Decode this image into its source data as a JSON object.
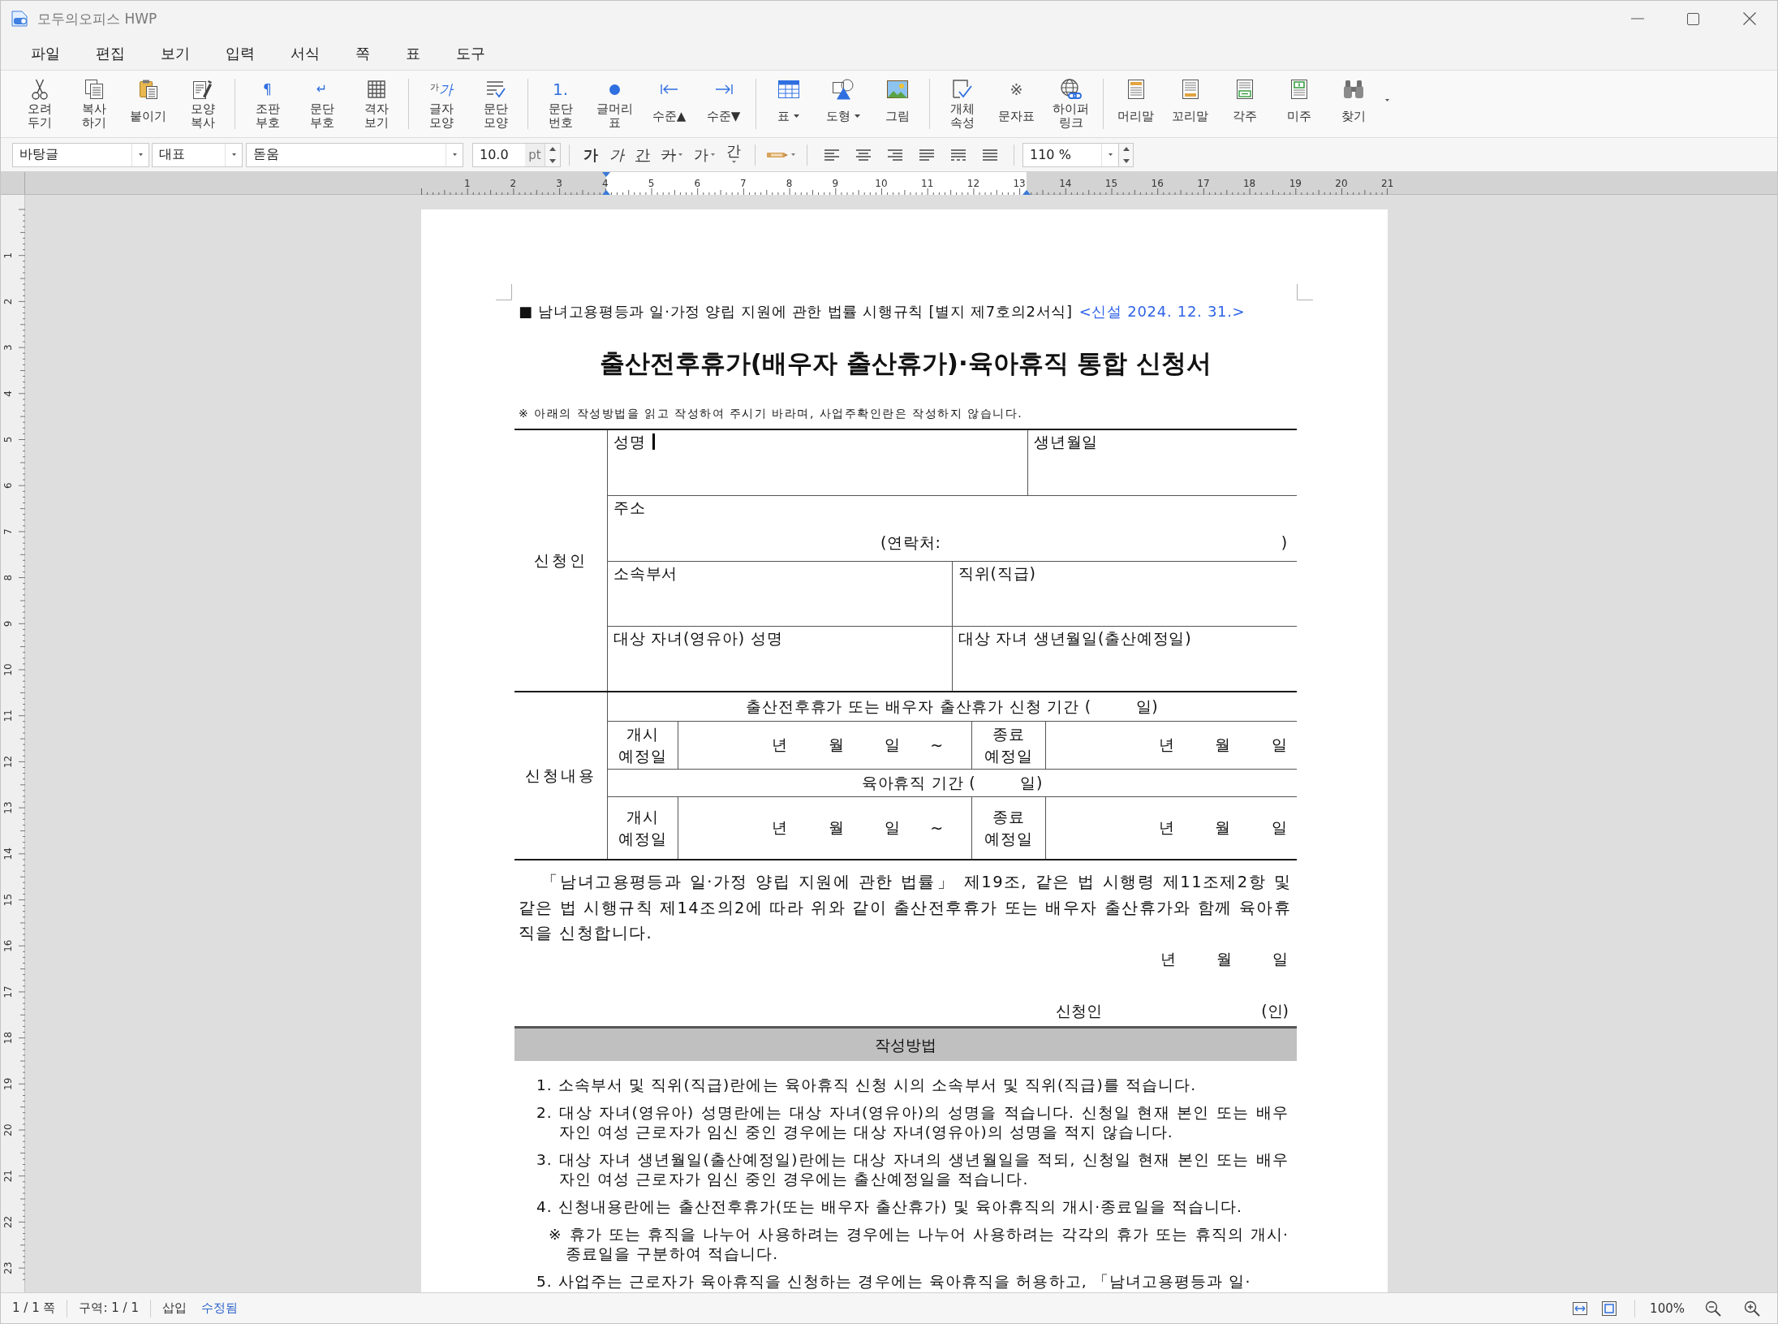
{
  "window": {
    "title": "모두의오피스 HWP"
  },
  "menu": [
    "파일",
    "편집",
    "보기",
    "입력",
    "서식",
    "쪽",
    "표",
    "도구"
  ],
  "toolbar": {
    "groups": [
      [
        {
          "label": "오려\n두기",
          "dropdown": false
        },
        {
          "label": "복사\n하기",
          "dropdown": false
        },
        {
          "label": "붙이기",
          "dropdown": false
        },
        {
          "label": "모양\n복사",
          "dropdown": false
        }
      ],
      [
        {
          "label": "조판\n부호",
          "dropdown": false,
          "glyph": [
            "¶"
          ]
        },
        {
          "label": "문단\n부호",
          "dropdown": false,
          "glyph": [
            "↵"
          ]
        },
        {
          "label": "격자\n보기",
          "dropdown": false
        }
      ],
      [
        {
          "label": "글자\n모양",
          "dropdown": false,
          "glyph": [
            "가",
            "가"
          ]
        },
        {
          "label": "문단\n모양",
          "dropdown": false
        }
      ],
      [
        {
          "label": "문단\n번호",
          "dropdown": false,
          "glyph": [
            "1."
          ]
        },
        {
          "label": "글머리\n표",
          "dropdown": false
        },
        {
          "label": "수준▲",
          "dropdown": false
        },
        {
          "label": "수준▼",
          "dropdown": false
        }
      ],
      [
        {
          "label": "표",
          "dropdown": true
        },
        {
          "label": "도형",
          "dropdown": true
        },
        {
          "label": "그림",
          "dropdown": false
        }
      ],
      [
        {
          "label": "개체\n속성",
          "dropdown": false
        },
        {
          "label": "문자표",
          "dropdown": false,
          "glyph": [
            "※"
          ]
        },
        {
          "label": "하이퍼\n링크",
          "dropdown": false
        }
      ],
      [
        {
          "label": "머리말",
          "dropdown": false
        },
        {
          "label": "꼬리말",
          "dropdown": false
        },
        {
          "label": "각주",
          "dropdown": false
        },
        {
          "label": "미주",
          "dropdown": false
        },
        {
          "label": "찾기",
          "dropdown": false
        }
      ]
    ],
    "more_menu": true
  },
  "format_bar": {
    "style": "바탕글",
    "language": "대표",
    "font": "돋움",
    "size": "10.0",
    "unit": "pt",
    "char_buttons": [
      {
        "kind": "bold",
        "label": "가",
        "dropdown": false
      },
      {
        "kind": "italic",
        "label": "가",
        "dropdown": false
      },
      {
        "kind": "underline",
        "label": "간",
        "dropdown": false
      },
      {
        "kind": "strike",
        "label": "가",
        "dropdown": true
      },
      {
        "kind": "color",
        "label": "가",
        "dropdown": true
      },
      {
        "kind": "spacing",
        "label": "간",
        "dropdown": true
      }
    ],
    "zoom": "110 %"
  },
  "ruler": {
    "horizontal": [
      "1",
      "2",
      "3",
      "4",
      "5",
      "6",
      "7",
      "8",
      "9",
      "10",
      "11",
      "12",
      "13",
      "14",
      "15",
      "16",
      "17",
      "18",
      "19",
      "20",
      "21"
    ],
    "vertical": [
      "1",
      "2",
      "3",
      "4",
      "5",
      "6",
      "7",
      "8",
      "9",
      "10",
      "11",
      "12",
      "13",
      "14",
      "15",
      "16",
      "17",
      "18",
      "19",
      "20",
      "21",
      "22",
      "23"
    ]
  },
  "document": {
    "form_reference": "■ 남녀고용평등과 일·가정 양립 지원에 관한 법률 시행규칙 [별지 제7호의2서식]",
    "amendment": "<신설 2024. 12. 31.>",
    "title": "출산전후휴가(배우자 출산휴가)·육아휴직 통합 신청서",
    "note": "※ 아래의 작성방법을 읽고 작성하여 주시기 바라며, 사업주확인란은 작성하지 않습니다.",
    "applicant": {
      "label": "신청인",
      "rows": [
        [
          {
            "label": "성명",
            "cursor": true
          },
          {
            "label": "생년월일",
            "cursor": false
          }
        ],
        [
          {
            "label": "주소",
            "cursor": false,
            "contact": "(연락처:",
            "contact_end": ")"
          }
        ],
        [
          {
            "label": "소속부서",
            "cursor": false
          },
          {
            "label": "직위(직급)",
            "cursor": false
          }
        ],
        [
          {
            "label": "대상 자녀(영유아) 성명",
            "cursor": false
          },
          {
            "label": "대상 자녀 생년월일(출산예정일)",
            "cursor": false
          }
        ]
      ]
    },
    "request": {
      "label": "신청내용",
      "periods": [
        {
          "heading": "출산전후휴가 또는 배우자 출산휴가 신청 기간 (        일)",
          "start_label": "개시\n예정일",
          "start_units": [
            "년",
            "월",
            "일"
          ],
          "range_mark": "~",
          "end_label": "종료\n예정일",
          "end_units": [
            "년",
            "월",
            "일"
          ]
        },
        {
          "heading": "육아휴직 기간 (        일)",
          "start_label": "개시\n예정일",
          "start_units": [
            "년",
            "월",
            "일"
          ],
          "range_mark": "~",
          "end_label": "종료\n예정일",
          "end_units": [
            "년",
            "월",
            "일"
          ]
        }
      ]
    },
    "declaration": "「남녀고용평등과 일·가정 양립 지원에 관한 법률」 제19조, 같은 법 시행령 제11조제2항 및 같은 법 시행규칙 제14조의2에 따라 위와 같이 출산전후휴가 또는 배우자 출산휴가와 함께 육아휴직을 신청합니다.",
    "date_units": [
      "년",
      "월",
      "일"
    ],
    "signature": {
      "label": "신청인",
      "seal": "(인)"
    },
    "instructions": {
      "title": "작성방법",
      "items": [
        {
          "kind": "step",
          "text": "1. 소속부서 및 직위(직급)란에는 육아휴직 신청 시의 소속부서 및 직위(직급)를 적습니다."
        },
        {
          "kind": "step",
          "text": "2. 대상 자녀(영유아) 성명란에는 대상 자녀(영유아)의 성명을 적습니다. 신청일 현재 본인 또는 배우자인 여성 근로자가 임신 중인 경우에는 대상 자녀(영유아)의 성명을 적지 않습니다."
        },
        {
          "kind": "step",
          "text": "3. 대상 자녀 생년월일(출산예정일)란에는 대상 자녀의 생년월일을 적되, 신청일 현재 본인 또는 배우자인 여성 근로자가 임신 중인 경우에는 출산예정일을 적습니다."
        },
        {
          "kind": "step",
          "text": "4. 신청내용란에는 출산전후휴가(또는 배우자 출산휴가) 및 육아휴직의 개시·종료일을 적습니다."
        },
        {
          "kind": "note",
          "text": "※ 휴가 또는 휴직을 나누어 사용하려는 경우에는 나누어 사용하려는 각각의 휴가 또는 휴직의 개시·종료일을 구분하여 적습니다."
        },
        {
          "kind": "step",
          "text": "5. 사업주는 근로자가 육아휴직을 신청하는 경우에는 육아휴직을 허용하고, 「남녀고용평등과 일·"
        }
      ]
    }
  },
  "status_bar": {
    "page": "1 / 1 쪽",
    "section": "구역: 1 / 1",
    "mode": "삽입",
    "modified": "수정됨",
    "zoom": "100%"
  }
}
